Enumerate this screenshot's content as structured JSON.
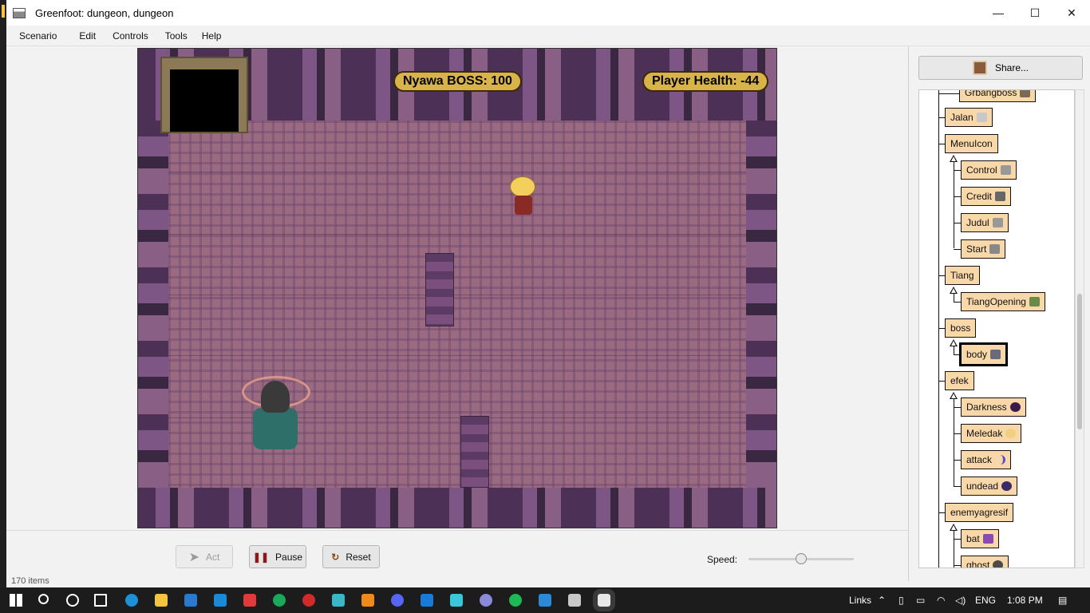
{
  "window": {
    "title": "Greenfoot: dungeon, dungeon",
    "controls": [
      "—",
      "☐",
      "✕"
    ]
  },
  "menu": [
    "Scenario",
    "Edit",
    "Controls",
    "Tools",
    "Help"
  ],
  "world": {
    "boss_hud": "Nyawa BOSS: 100",
    "player_hud": "Player Health: -44"
  },
  "controls": {
    "act_label": "Act",
    "pause_label": "Pause",
    "reset_label": "Reset",
    "speed_label": "Speed:",
    "speed_value": 0.5
  },
  "status": "170 items",
  "sidebar": {
    "share_label": "Share...",
    "classes": [
      {
        "name": "Grbangboss",
        "icon": "boss-sprite-icon",
        "color": "#7a6a55"
      },
      {
        "name": "Jalan",
        "icon": "floor-tile-icon",
        "color": "#c8c8c8"
      },
      {
        "name": "MenuIcon",
        "icon": "",
        "color": ""
      },
      {
        "name": "Control",
        "icon": "control-sprite-icon",
        "color": "#999999"
      },
      {
        "name": "Credit",
        "icon": "credit-sprite-icon",
        "color": "#666666"
      },
      {
        "name": "Judul",
        "icon": "title-sprite-icon",
        "color": "#999999"
      },
      {
        "name": "Start",
        "icon": "start-sprite-icon",
        "color": "#888888"
      },
      {
        "name": "Tiang",
        "icon": "",
        "color": ""
      },
      {
        "name": "TiangOpening",
        "icon": "pillar-sprite-icon",
        "color": "#6a8a4a"
      },
      {
        "name": "boss",
        "icon": "",
        "color": ""
      },
      {
        "name": "body",
        "icon": "boss-body-sprite-icon",
        "color": "#6a6a7a"
      },
      {
        "name": "efek",
        "icon": "",
        "color": ""
      },
      {
        "name": "Darkness",
        "icon": "darkness-sprite-icon",
        "color": "#3a1a4a"
      },
      {
        "name": "Meledak",
        "icon": "explosion-sprite-icon",
        "color": "#f0d080"
      },
      {
        "name": "attack",
        "icon": "attack-sprite-icon",
        "color": "#5a4ad0"
      },
      {
        "name": "undead",
        "icon": "undead-sprite-icon",
        "color": "#3a2a6a"
      },
      {
        "name": "enemyagresif",
        "icon": "",
        "color": ""
      },
      {
        "name": "bat",
        "icon": "bat-sprite-icon",
        "color": "#8a4ab0"
      },
      {
        "name": "ghost",
        "icon": "ghost-sprite-icon",
        "color": "#4a4a4a"
      }
    ]
  },
  "taskbar": {
    "links_label": "Links",
    "language": "ENG",
    "time": "1:08 PM"
  }
}
